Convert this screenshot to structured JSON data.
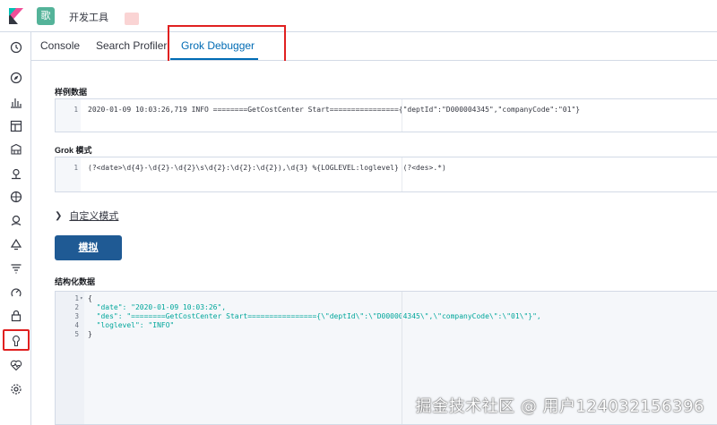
{
  "header": {
    "app_badge": "歌",
    "title": "开发工具"
  },
  "nav": {
    "icons": [
      "clock-icon",
      "compass-icon",
      "bar-chart-icon",
      "dashboard-icon",
      "canvas-icon",
      "maps-icon",
      "ml-icon",
      "graph-icon",
      "apm-icon",
      "uptime-icon",
      "siem-icon",
      "security-icon",
      "dev-tools-icon",
      "monitoring-icon",
      "management-icon"
    ]
  },
  "tabs": {
    "console": "Console",
    "search_profiler": "Search Profiler",
    "grok_debugger": "Grok Debugger"
  },
  "sample": {
    "label": "样例数据",
    "lines": [
      {
        "num": "1",
        "text": "2020-01-09 10:03:26,719 INFO ========GetCostCenter Start================{\"deptId\":\"D000004345\",\"companyCode\":\"01\"}"
      }
    ]
  },
  "grok": {
    "label": "Grok 模式",
    "lines": [
      {
        "num": "1",
        "text": "(?<date>\\d{4}-\\d{2}-\\d{2}\\s\\d{2}:\\d{2}:\\d{2}),\\d{3} %{LOGLEVEL:loglevel} (?<des>.*)"
      }
    ]
  },
  "custom_patterns": {
    "label": "自定义模式"
  },
  "simulate": {
    "label": "模拟"
  },
  "structured": {
    "label": "结构化数据",
    "line_numbers": [
      "1",
      "2",
      "3",
      "4",
      "5"
    ],
    "lines": [
      "{",
      "  \"date\": \"2020-01-09 10:03:26\",",
      "  \"des\": \"========GetCostCenter Start================{\\\"deptId\\\":\\\"D000004345\\\",\\\"companyCode\\\":\\\"01\\\"}\",",
      "  \"loglevel\": \"INFO\"",
      "}"
    ]
  },
  "watermark": "掘金技术社区 @ 用户124032156396",
  "colors": {
    "accent": "#006bb4",
    "highlight": "#e02020",
    "button": "#1f5a94",
    "json_string": "#00a69b"
  }
}
